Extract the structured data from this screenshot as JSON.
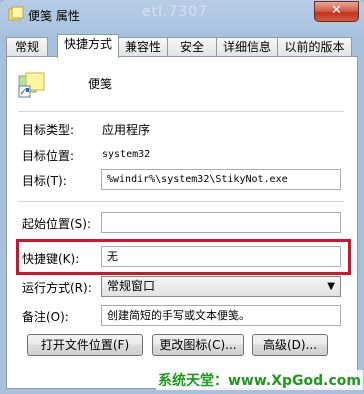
{
  "window": {
    "title": "便笺 属性",
    "ghost_title": "etl.7307",
    "close_label": "✕"
  },
  "tabs": [
    {
      "label": "常规"
    },
    {
      "label": "快捷方式"
    },
    {
      "label": "兼容性"
    },
    {
      "label": "安全"
    },
    {
      "label": "详细信息"
    },
    {
      "label": "以前的版本"
    }
  ],
  "shortcut": {
    "app_name": "便笺",
    "target_type_label": "目标类型:",
    "target_type_value": "应用程序",
    "target_location_label": "目标位置:",
    "target_location_value": "system32",
    "target_label": "目标(T):",
    "target_value": "%windir%\\system32\\StikyNot.exe",
    "start_in_label": "起始位置(S):",
    "start_in_value": "",
    "hotkey_label": "快捷键(K):",
    "hotkey_value": "无",
    "run_label": "运行方式(R):",
    "run_value": "常规窗口",
    "comment_label": "备注(O):",
    "comment_value": "创建简短的手写或文本便笺。"
  },
  "buttons": {
    "open_location": "打开文件位置(F)",
    "change_icon": "更改图标(C)...",
    "advanced": "高级(D)..."
  },
  "watermark": "系统天堂：www.XpGod.com",
  "colors": {
    "highlight_border": "#d2142a",
    "watermark": "#1b9a1b"
  }
}
